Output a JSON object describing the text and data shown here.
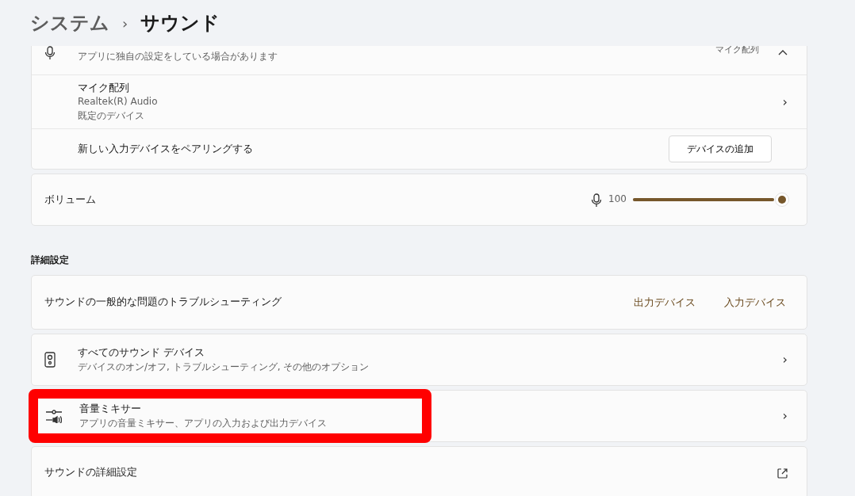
{
  "breadcrumb": {
    "parent": "システム",
    "separator": "›",
    "current": "サウンド"
  },
  "input_group": [
    {
      "kind": "partial",
      "subtitle": "アプリに独自の設定をしている場合があります",
      "value": "マイク配列",
      "expanded": true
    },
    {
      "kind": "device",
      "title": "マイク配列",
      "lines": [
        "Realtek(R) Audio",
        "既定のデバイス"
      ],
      "chevron": "›"
    },
    {
      "kind": "pair",
      "title": "新しい入力デバイスをペアリングする",
      "button": "デバイスの追加"
    }
  ],
  "volume": {
    "label": "ボリューム",
    "reading": "100",
    "level": 1.0
  },
  "section_heading": "詳細設定",
  "troubleshoot": {
    "label": "サウンドの一般的な問題のトラブルシューティング",
    "links": [
      "出力デバイス",
      "入力デバイス"
    ]
  },
  "items": [
    {
      "kind": "speaker",
      "title": "すべてのサウンド デバイス",
      "subtitle": "デバイスのオン/オフ, トラブルシューティング, その他のオプション",
      "chevron": "›",
      "external_link": false,
      "highlighted": false
    },
    {
      "kind": "mixer",
      "title": "音量ミキサー",
      "subtitle": "アプリの音量ミキサー、アプリの入力および出力デバイス",
      "chevron": "›",
      "external_link": false,
      "highlighted": true
    },
    {
      "kind": "plain",
      "title": "サウンドの詳細設定",
      "external_link": true,
      "highlighted": false
    }
  ]
}
